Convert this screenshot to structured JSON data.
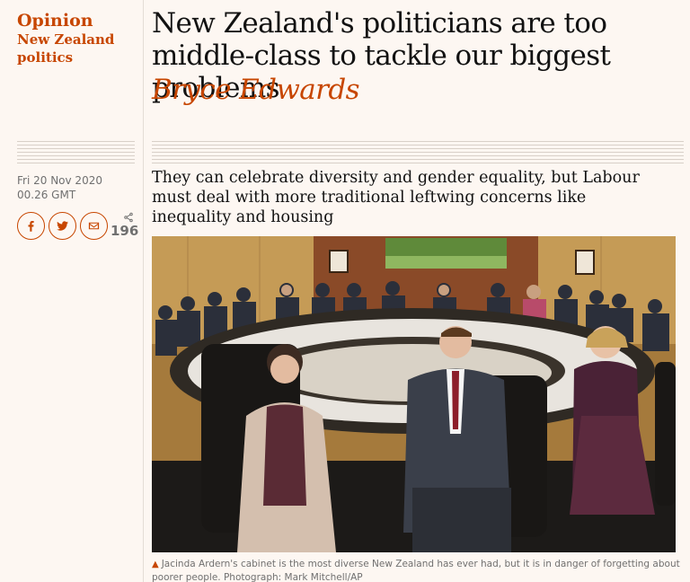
{
  "article": {
    "section": "Opinion",
    "series": "New Zealand politics",
    "headline": "New Zealand's politicians are too middle-class to tackle our biggest problems",
    "byline": "Bryce Edwards",
    "date": "Fri 20 Nov 2020",
    "time": "00.26 GMT",
    "standfirst": "They can celebrate diversity and gender equality, but Labour must deal with more traditional leftwing concerns like inequality and housing",
    "caption": "Jacinda Ardern's cabinet is the most diverse New Zealand has ever had, but it is in danger of forgetting about poorer people. Photograph: Mark Mitchell/AP"
  },
  "share": {
    "count": "196",
    "icons": [
      "facebook-icon",
      "twitter-icon",
      "email-icon",
      "share-icon"
    ]
  },
  "colors": {
    "accent": "#c74600",
    "background": "#fdf7f2",
    "text": "#121212",
    "muted": "#707070"
  }
}
